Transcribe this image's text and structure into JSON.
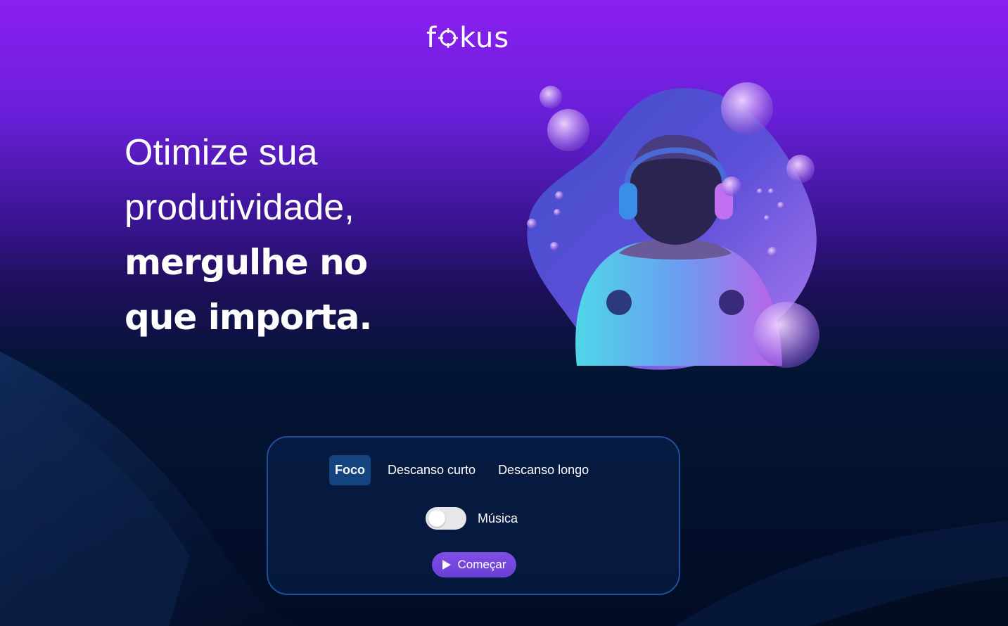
{
  "brand": {
    "logo_prefix": "f",
    "logo_suffix": "kus",
    "logo_icon": "target-o-icon"
  },
  "hero": {
    "line1": "Otimize sua",
    "line2": "produtividade,",
    "line3": "mergulhe no",
    "line4": "que importa.",
    "illustration": "person-with-headphones-underwater-bubbles"
  },
  "timer_card": {
    "tabs": [
      {
        "label": "Foco",
        "active": true
      },
      {
        "label": "Descanso curto",
        "active": false
      },
      {
        "label": "Descanso longo",
        "active": false
      }
    ],
    "music_toggle": {
      "label": "Música",
      "on": false
    },
    "start_button": {
      "label": "Começar",
      "icon": "play-icon"
    }
  },
  "colors": {
    "bg_top": "#8b1ff1",
    "bg_bottom": "#020c24",
    "card_border": "#1e4f9a",
    "active_tab": "#144480",
    "button": "#7f4fe6"
  }
}
